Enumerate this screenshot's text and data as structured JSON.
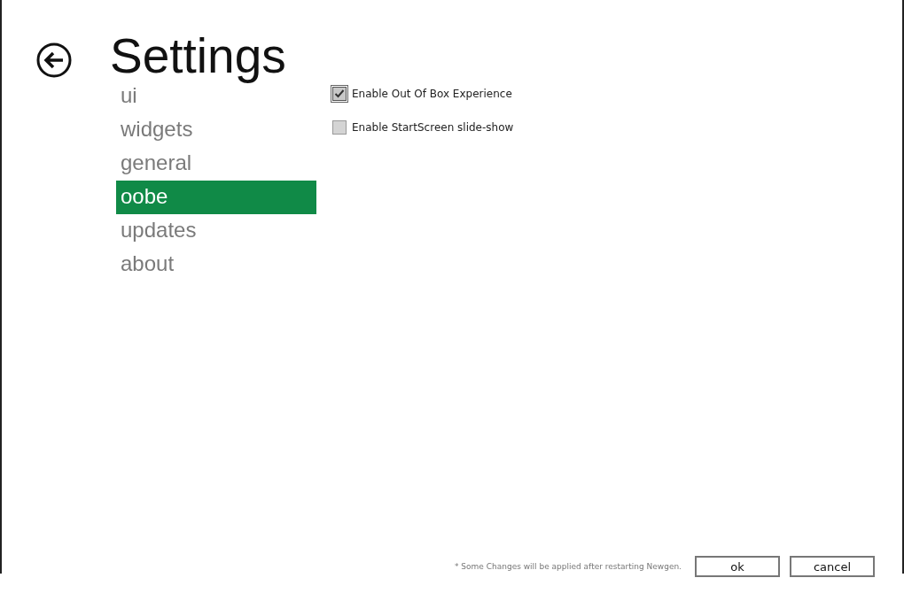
{
  "header": {
    "title": "Settings"
  },
  "nav": [
    {
      "label": "ui",
      "selected": false
    },
    {
      "label": "widgets",
      "selected": false
    },
    {
      "label": "general",
      "selected": false
    },
    {
      "label": "oobe",
      "selected": true
    },
    {
      "label": "updates",
      "selected": false
    },
    {
      "label": "about",
      "selected": false
    }
  ],
  "options": [
    {
      "label": "Enable Out Of Box Experience",
      "checked": true,
      "focused": true
    },
    {
      "label": "Enable StartScreen slide-show",
      "checked": false,
      "focused": false
    }
  ],
  "footer": {
    "note": "* Some Changes will be applied after restarting Newgen.",
    "buttons": [
      "ok",
      "cancel"
    ]
  }
}
